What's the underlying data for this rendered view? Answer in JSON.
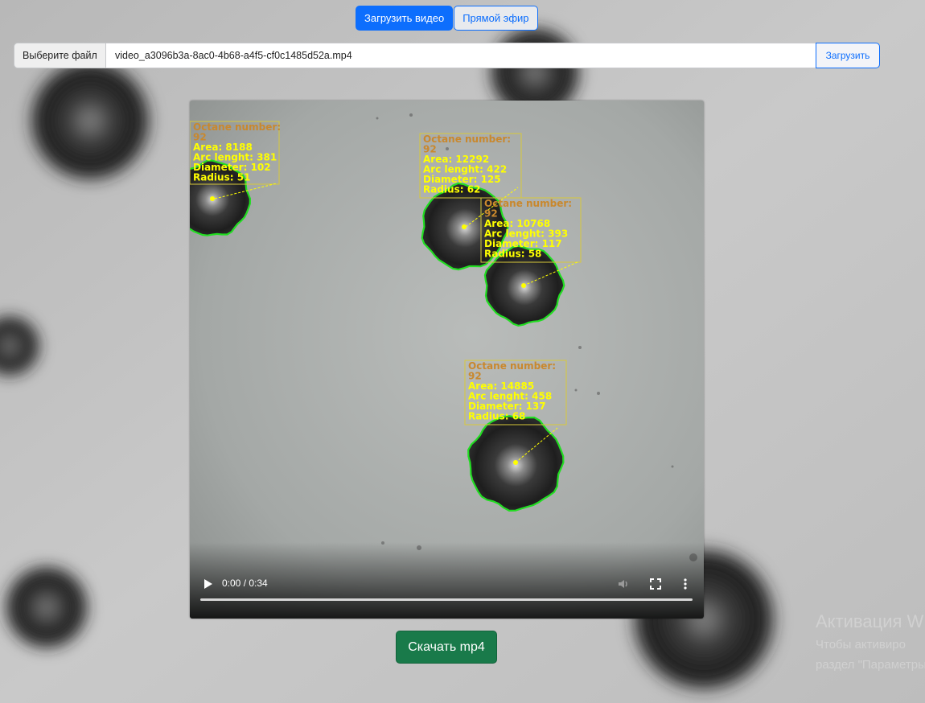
{
  "mode_toggle": {
    "upload_video": "Загрузить видео",
    "live_stream": "Прямой эфир"
  },
  "file_input": {
    "choose_label": "Выберите файл",
    "file_name": "video_a3096b3a-8ac0-4b68-a4f5-cf0c1485d52a.mp4",
    "upload_label": "Загрузить"
  },
  "video": {
    "time_display": "0:00 / 0:34",
    "progress": 0,
    "overlay_color": "#ffff00",
    "contour_color": "#22dd22",
    "annotations": [
      {
        "title": "Octane number:",
        "octane": "92",
        "area": "Area: 8188",
        "arc": "Arc lenght: 381",
        "diameter": "Diameter: 102",
        "radius": "Radius: 51"
      },
      {
        "title": "Octane number:",
        "octane": "92",
        "area": "Area: 12292",
        "arc": "Arc lenght: 422",
        "diameter": "Diameter: 125",
        "radius": "Radius: 62"
      },
      {
        "title": "Octane number:",
        "octane": "92",
        "area": "Area: 10768",
        "arc": "Arc lenght: 393",
        "diameter": "Diameter: 117",
        "radius": "Radius: 58"
      },
      {
        "title": "Octane number:",
        "octane": "92",
        "area": "Area: 14885",
        "arc": "Arc lenght: 458",
        "diameter": "Diameter: 137",
        "radius": "Radius: 68"
      }
    ]
  },
  "download": {
    "label": "Скачать mp4"
  },
  "watermark": {
    "line1": "Активация W",
    "line2": "Чтобы активиро",
    "line3": "раздел \"Параметры\""
  }
}
